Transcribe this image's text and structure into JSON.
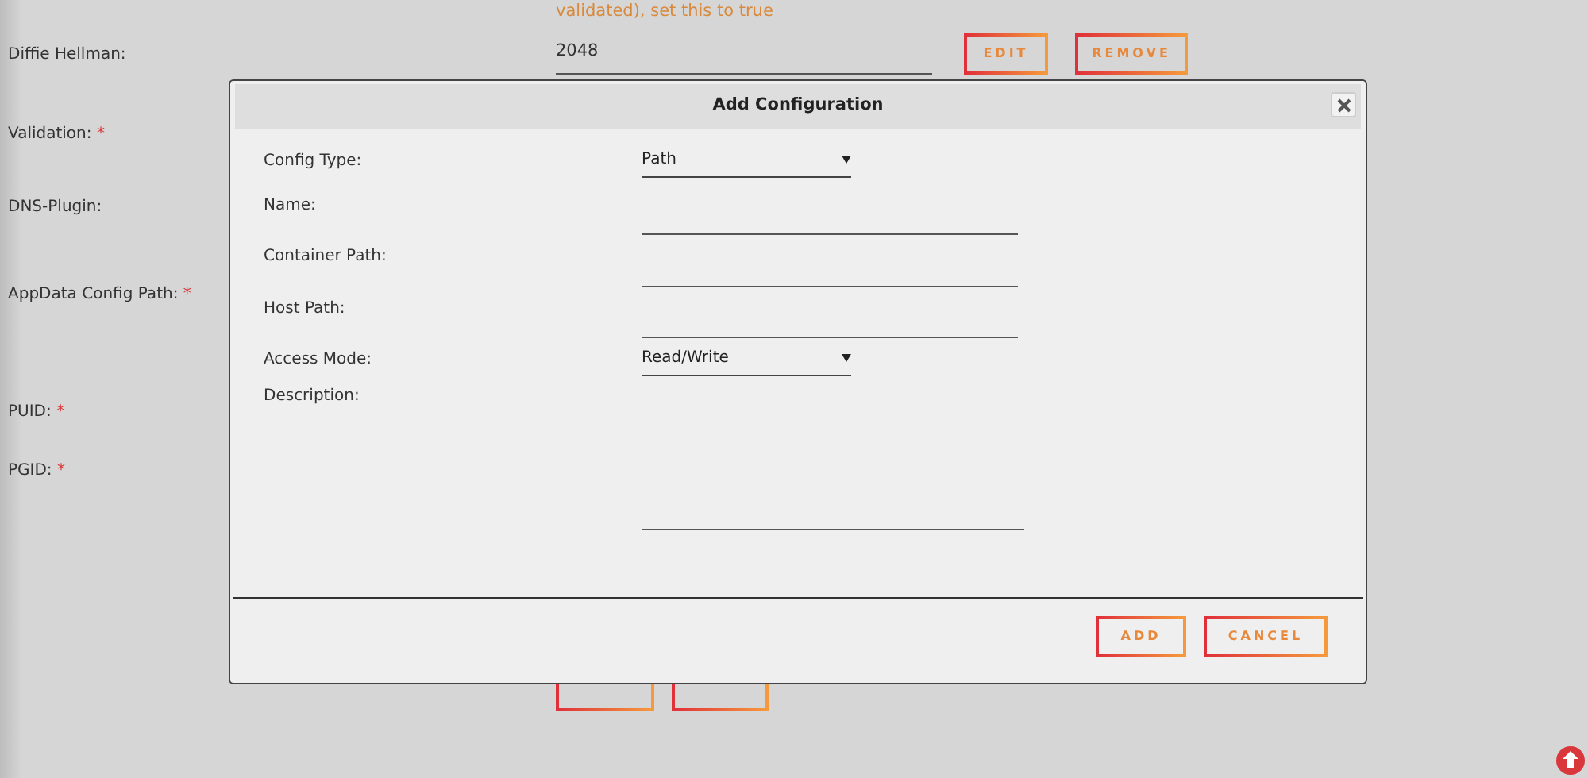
{
  "background_form": {
    "note": "validated), set this to true",
    "fields": [
      {
        "label": "Diffie Hellman:",
        "value": "2048",
        "buttons": [
          "EDIT",
          "REMOVE"
        ]
      },
      {
        "label": "Validation:",
        "required_mark": "*"
      },
      {
        "label": "DNS-Plugin:"
      },
      {
        "label": "AppData Config Path:",
        "required_mark": "*"
      },
      {
        "label": "PUID:",
        "required_mark": "*"
      },
      {
        "label": "PGID:",
        "required_mark": "*"
      }
    ]
  },
  "dialog": {
    "title": "Add Configuration",
    "fields": [
      {
        "label": "Config Type:",
        "kind": "select",
        "value": "Path"
      },
      {
        "label": "Name:",
        "kind": "text"
      },
      {
        "label": "Container Path:",
        "kind": "text"
      },
      {
        "label": "Host Path:",
        "kind": "text"
      },
      {
        "label": "Access Mode:",
        "kind": "select",
        "value": "Read/Write"
      },
      {
        "label": "Description:",
        "kind": "textarea"
      }
    ],
    "buttons": [
      "ADD",
      "CANCEL"
    ]
  }
}
